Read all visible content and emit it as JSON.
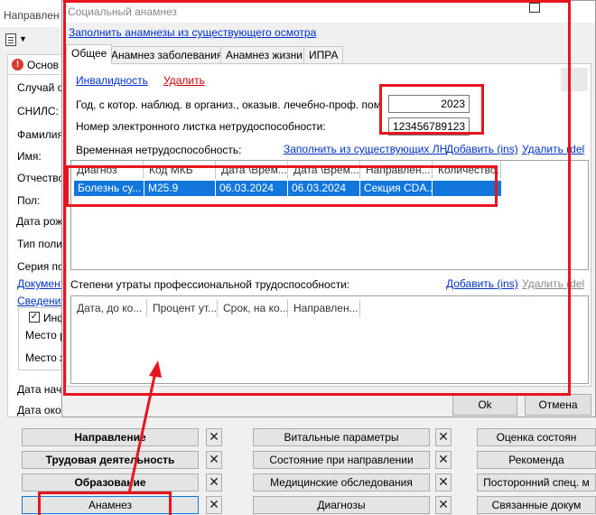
{
  "background": {
    "window_title": "Направлен",
    "tab_label": "Основ",
    "fields": [
      "Случай о",
      "СНИЛС:",
      "Фамилия",
      "Имя:",
      "Отчество",
      "Пол:",
      "Дата рожд",
      "Тип полис",
      "Серия пол"
    ],
    "links": [
      "Документ",
      "Сведения"
    ],
    "group_checkbox_label": "Инф",
    "group_fields": [
      "Место р",
      "Место ж"
    ],
    "date_fields": [
      "Дата нач",
      "Дата око"
    ]
  },
  "bottom_buttons": {
    "left": [
      "Направление",
      "Трудовая деятельность",
      "Образование",
      "Анамнез"
    ],
    "middle": [
      "Витальные параметры",
      "Состояние при направлении",
      "Медицинские обследования",
      "Диагнозы"
    ],
    "right": [
      "Оценка состоян",
      "Рекоменда",
      "Посторонний спец. м",
      "Связанные докум"
    ],
    "close_glyph": "✕"
  },
  "dialog": {
    "title": "Социальный анамнез",
    "fill_link": "Заполнить анамнезы из существующего осмотра",
    "tabs": [
      "Общее",
      "Анамнез заболевания",
      "Анамнез жизни",
      "ИПРА"
    ],
    "active_tab": "Общее",
    "disability_link": "Инвалидность",
    "delete_link": "Удалить",
    "year_label": "Год, с котор. наблюд. в организ., оказыв. лечебно-проф. помощь",
    "year_value": "2023",
    "eln_label": "Номер электронного листка нетрудоспособности:",
    "eln_value": "123456789123",
    "temp_disability": {
      "label": "Временная нетрудоспособность:",
      "fill_link": "Заполнить из существующих ЛН",
      "add_link": "Добавить (ins)",
      "delete_link": "Удалить (del)",
      "columns": [
        "Диагноз",
        "Код МКБ",
        "Дата \\Врем...",
        "Дата \\Врем...",
        "Направлен...",
        "Количество..."
      ],
      "rows": [
        [
          "Болезнь су...",
          "M25.9",
          "06.03.2024",
          "06.03.2024",
          "Секция CDA...",
          ""
        ]
      ]
    },
    "prof_loss": {
      "label": "Степени утраты профессиональной трудоспособности:",
      "add_link": "Добавить (ins)",
      "delete_link": "Удалить (del)",
      "columns": [
        "Дата, до ко...",
        "Процент ут...",
        "Срок, на ко...",
        "Направлен..."
      ]
    },
    "ok_label": "Ok",
    "cancel_label": "Отмена"
  },
  "colors": {
    "annotation": "#e8141e",
    "link": "#0033cc",
    "selection": "#1177dd"
  }
}
